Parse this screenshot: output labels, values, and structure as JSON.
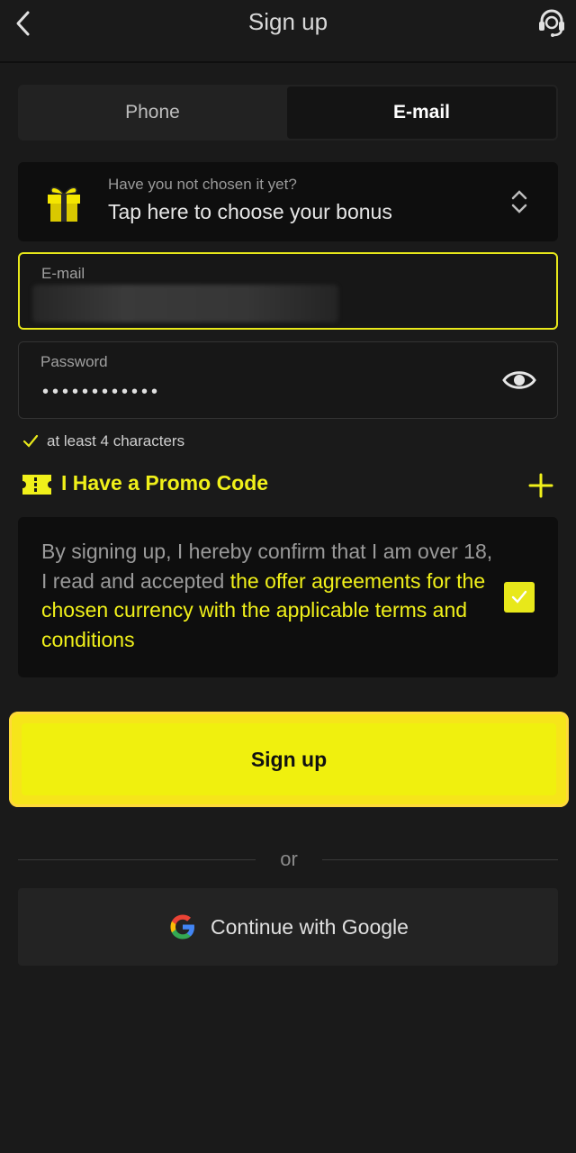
{
  "header": {
    "title": "Sign up",
    "back_icon": "chevron-left-icon",
    "support_icon": "headset-support-icon"
  },
  "tabs": [
    {
      "label": "Phone",
      "active": false
    },
    {
      "label": "E-mail",
      "active": true
    }
  ],
  "bonus": {
    "hint": "Have you not chosen it yet?",
    "label": "Tap here to choose your bonus",
    "icon": "gift-icon",
    "chevron_icon": "chevron-up-down-icon"
  },
  "email_field": {
    "label": "E-mail",
    "value_redacted": true
  },
  "password_field": {
    "label": "Password",
    "masked_value": "••••••••••••",
    "toggle_icon": "eye-icon"
  },
  "validation": {
    "text": "at least 4 characters",
    "icon": "check-icon"
  },
  "promo": {
    "label": "I Have a Promo Code",
    "icon": "ticket-icon",
    "expand_icon": "plus-icon"
  },
  "agreement": {
    "text_plain": "By signing up, I hereby confirm that I am over 18, I read and accepted ",
    "text_link": "the offer agreements for the chosen currency with the applicable terms and conditions",
    "checked": true
  },
  "signup_button": {
    "label": "Sign up"
  },
  "divider": {
    "label": "or"
  },
  "google_button": {
    "label": "Continue with Google",
    "icon": "google-icon"
  },
  "colors": {
    "background": "#1a1a1a",
    "accent_yellow": "#f0f00e",
    "panel_dark": "#0e0e0e",
    "text_muted": "#9a9a9a"
  }
}
